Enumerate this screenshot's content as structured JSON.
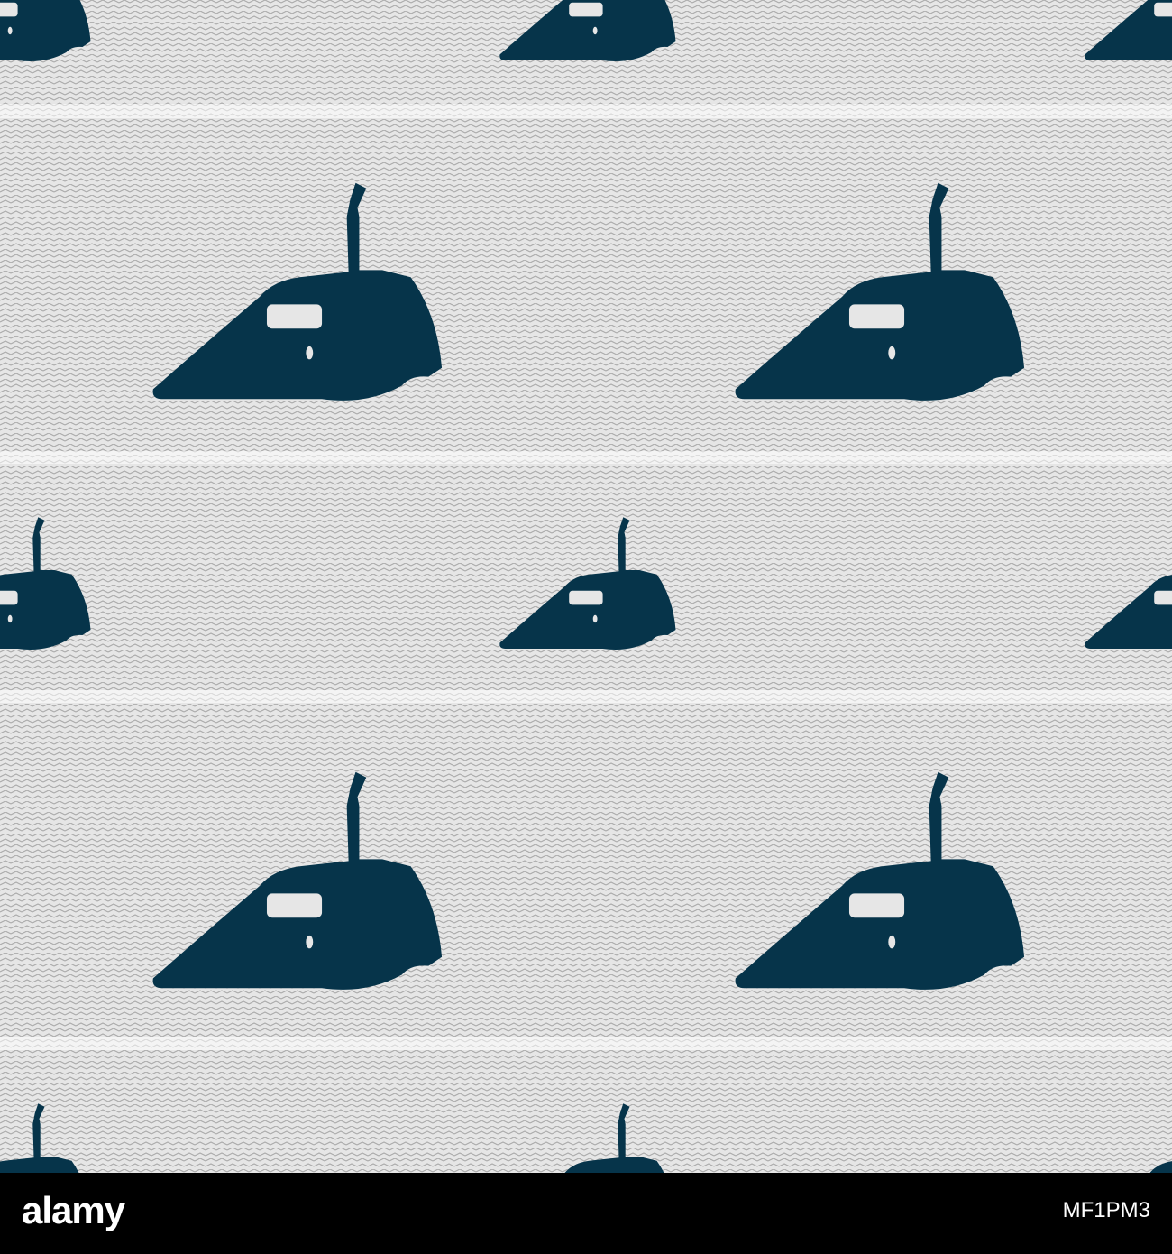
{
  "pattern": {
    "icon_name": "iron-icon",
    "icon_color": "#06344a",
    "background_color": "#e6e6e6",
    "stripe_color": "#a9a9a9",
    "highlight_color": "#ffffff"
  },
  "footer": {
    "brand": "alamy",
    "image_code": "MF1PM3",
    "background_color": "#000000"
  }
}
